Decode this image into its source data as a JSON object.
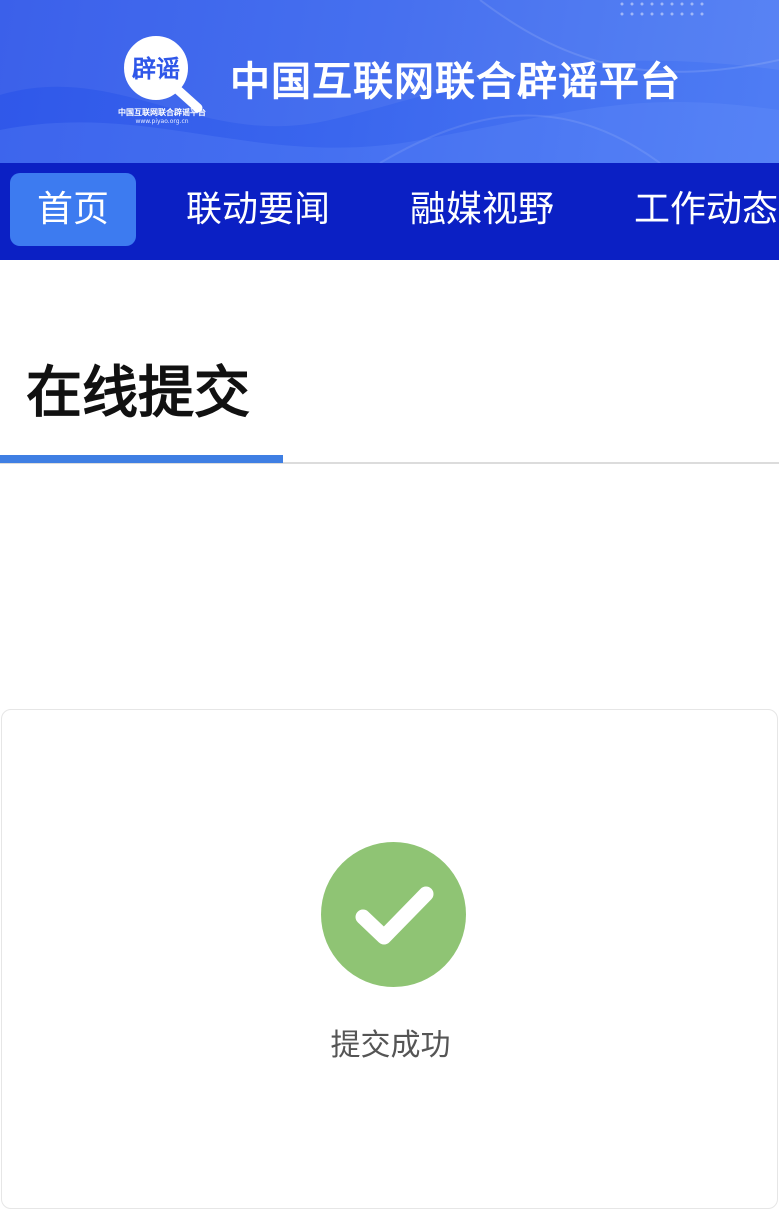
{
  "header": {
    "logo_icon": "piyao-magnifier-logo",
    "logo_text": "辟谣",
    "logo_sub": "中国互联网联合辟谣平台",
    "logo_url": "www.piyao.org.cn",
    "site_title": "中国互联网联合辟谣平台"
  },
  "nav": {
    "items": [
      {
        "label": "首页",
        "active": true
      },
      {
        "label": "联动要闻",
        "active": false
      },
      {
        "label": "融媒视野",
        "active": false
      },
      {
        "label": "工作动态",
        "active": false
      }
    ]
  },
  "section": {
    "title": "在线提交"
  },
  "result": {
    "icon": "check-circle-icon",
    "message": "提交成功"
  },
  "colors": {
    "banner": "#3a66ee",
    "nav_bg": "#0b20c4",
    "nav_active": "#3d7bf0",
    "underline": "#3f7fe3",
    "success": "#8fc474"
  }
}
